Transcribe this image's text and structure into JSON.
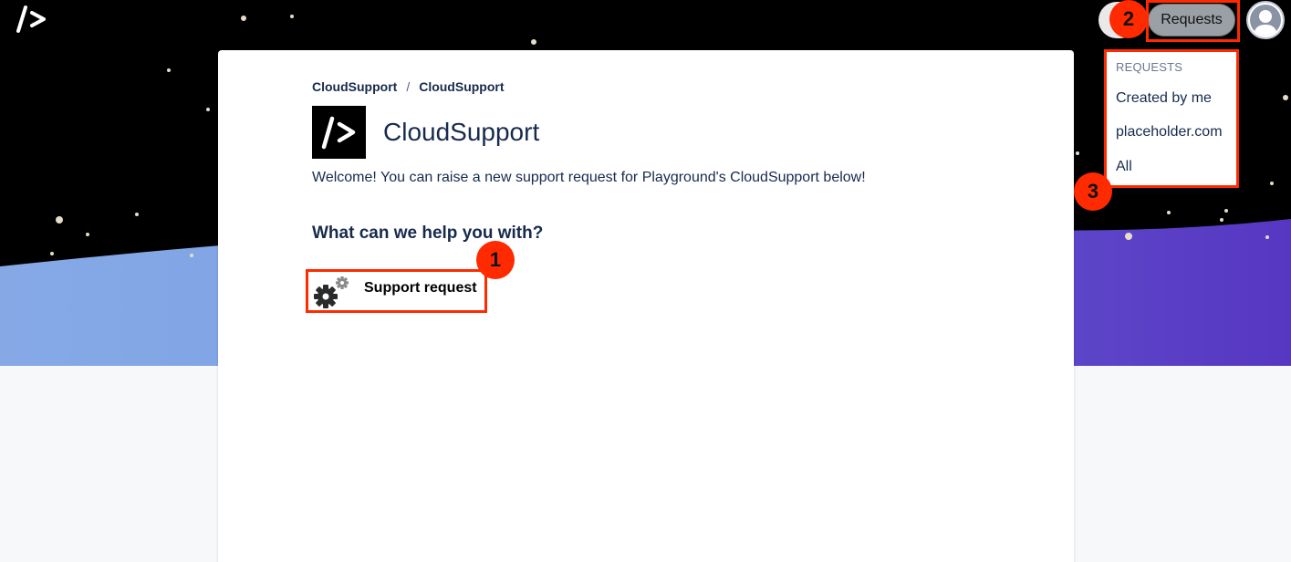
{
  "header": {
    "requests_button_label": "Requests"
  },
  "requests_menu": {
    "heading": "REQUESTS",
    "items": [
      "Created by me",
      "placeholder.com",
      "All"
    ]
  },
  "portal": {
    "breadcrumb": [
      "CloudSupport",
      "CloudSupport"
    ],
    "breadcrumb_separator": "/",
    "title": "CloudSupport",
    "welcome_text": "Welcome! You can raise a new support request for Playground's CloudSupport below!",
    "help_heading": "What can we help you with?",
    "request_types": [
      {
        "label": "Support request",
        "icon": "gears-icon"
      }
    ]
  },
  "annotations": {
    "markers": [
      "1",
      "2",
      "3"
    ],
    "color": "#ff2a00"
  },
  "colors": {
    "hero_background": "#000000",
    "wave_light": "#7ea5e3",
    "wave_purple": "#5b3fc4",
    "card": "#ffffff"
  }
}
